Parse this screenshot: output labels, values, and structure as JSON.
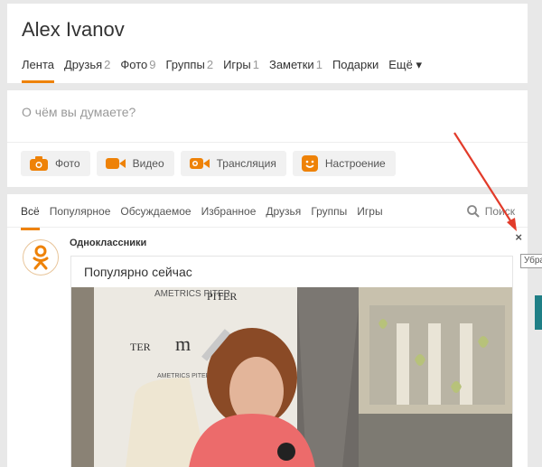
{
  "profile": {
    "name": "Alex Ivanov",
    "nav": [
      {
        "label": "Лента",
        "count": "",
        "active": true
      },
      {
        "label": "Друзья",
        "count": "2"
      },
      {
        "label": "Фото",
        "count": "9"
      },
      {
        "label": "Группы",
        "count": "2"
      },
      {
        "label": "Игры",
        "count": "1"
      },
      {
        "label": "Заметки",
        "count": "1"
      },
      {
        "label": "Подарки",
        "count": ""
      },
      {
        "label": "Ещё ▾",
        "count": ""
      }
    ]
  },
  "composer": {
    "placeholder": "О чём вы думаете?",
    "actions": [
      {
        "label": "Фото",
        "icon": "camera-icon"
      },
      {
        "label": "Видео",
        "icon": "video-camera-icon"
      },
      {
        "label": "Трансляция",
        "icon": "broadcast-icon"
      },
      {
        "label": "Настроение",
        "icon": "smiley-icon"
      }
    ]
  },
  "feed": {
    "tabs": [
      "Всё",
      "Популярное",
      "Обсуждаемое",
      "Избранное",
      "Друзья",
      "Группы",
      "Игры"
    ],
    "search_label": "Поиск",
    "post": {
      "author": "Одноклассники",
      "close_glyph": "×",
      "title": "Популярно сейчас",
      "video_brand": "METRICS PITER"
    }
  },
  "tooltip": "Убра",
  "colors": {
    "accent": "#ee8208",
    "annotation": "#e23b2a"
  }
}
